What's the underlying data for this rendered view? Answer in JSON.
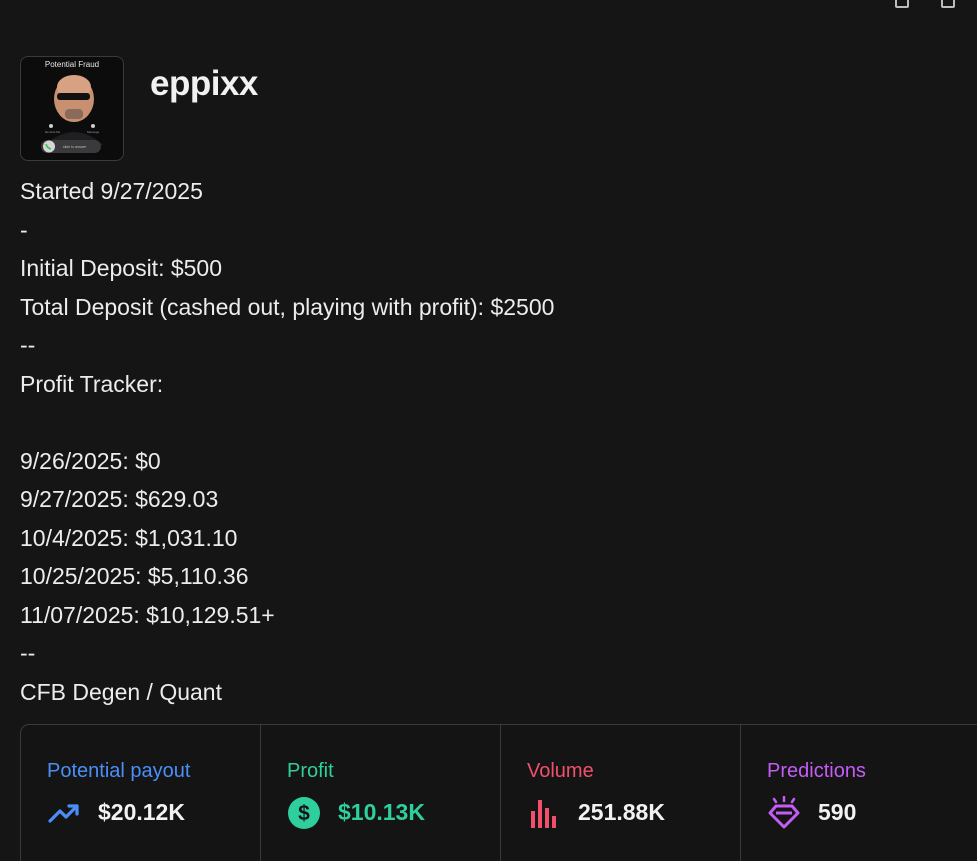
{
  "profile": {
    "username": "eppixx",
    "avatar_caption": "Potential Fraud"
  },
  "bio": {
    "lines": [
      "Started 9/27/2025",
      "-",
      "Initial Deposit: $500",
      "Total Deposit (cashed out, playing with profit): $2500",
      "--",
      "Profit Tracker:",
      "",
      "9/26/2025: $0",
      "9/27/2025: $629.03",
      "10/4/2025: $1,031.10",
      "10/25/2025: $5,110.36",
      "11/07/2025: $10,129.51+",
      "--",
      "CFB Degen / Quant"
    ]
  },
  "stats": [
    {
      "label": "Potential payout",
      "value": "$20.12K",
      "icon": "trending-up-icon",
      "label_color": "#4a8ff7",
      "icon_color": "#4a8ff7",
      "value_color": "#f2f2f2"
    },
    {
      "label": "Profit",
      "value": "$10.13K",
      "icon": "dollar-circle-icon",
      "label_color": "#2ecf9c",
      "icon_color": "#2ecf9c",
      "value_color": "#2ecf9c"
    },
    {
      "label": "Volume",
      "value": "251.88K",
      "icon": "bar-chart-icon",
      "label_color": "#f0506b",
      "icon_color": "#f0506b",
      "value_color": "#f2f2f2"
    },
    {
      "label": "Predictions",
      "value": "590",
      "icon": "diamond-icon",
      "label_color": "#c45cf5",
      "icon_color": "#c45cf5",
      "value_color": "#f2f2f2"
    }
  ]
}
